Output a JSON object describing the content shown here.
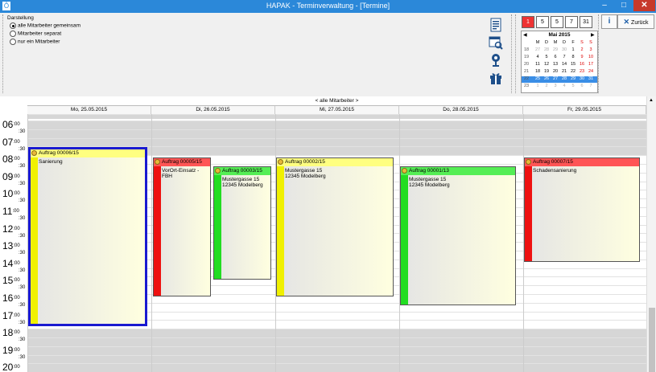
{
  "window": {
    "title": "HAPAK - Terminverwaltung - [Termine]",
    "minimize": "–",
    "maximize": "□",
    "close": "✕"
  },
  "display": {
    "group_label": "Darstellung",
    "options": [
      "alle Mitarbeiter gemeinsam",
      "Mitarbeiter separat",
      "nur ein Mitarbeiter"
    ],
    "selected": 0
  },
  "toolbar_icons": [
    "document-icon",
    "calendar-search-icon",
    "print-person-icon",
    "gift-icon"
  ],
  "view_buttons": [
    {
      "label": "1",
      "icon": "day-view-icon"
    },
    {
      "label": "5",
      "icon": "workweek-view-icon"
    },
    {
      "label": "5",
      "icon": "week-view-icon"
    },
    {
      "label": "7",
      "icon": "full-week-view-icon"
    },
    {
      "label": "31",
      "icon": "month-view-icon"
    }
  ],
  "calendar": {
    "month": "Mai 2015",
    "prev": "◀",
    "next": "▶",
    "weekdays": [
      "M",
      "D",
      "M",
      "D",
      "F",
      "S",
      "S"
    ],
    "weeks": [
      {
        "kw": "18",
        "days": [
          "27",
          "28",
          "29",
          "30",
          "1",
          "2",
          "3"
        ]
      },
      {
        "kw": "19",
        "days": [
          "4",
          "5",
          "6",
          "7",
          "8",
          "9",
          "10"
        ]
      },
      {
        "kw": "20",
        "days": [
          "11",
          "12",
          "13",
          "14",
          "15",
          "16",
          "17"
        ]
      },
      {
        "kw": "21",
        "days": [
          "18",
          "19",
          "20",
          "21",
          "22",
          "23",
          "24"
        ]
      },
      {
        "kw": "22",
        "days": [
          "25",
          "26",
          "27",
          "28",
          "29",
          "30",
          "31"
        ]
      },
      {
        "kw": "23",
        "days": [
          "1",
          "2",
          "3",
          "4",
          "5",
          "6",
          "7"
        ]
      }
    ]
  },
  "buttons": {
    "info": "i",
    "back": "Zurück",
    "back_icon": "✕"
  },
  "schedule": {
    "employee_header": "< alle Mitarbeiter >",
    "days": [
      "Mo, 25.05.2015",
      "Di, 26.05.2015",
      "Mi, 27.05.2015",
      "Do, 28.05.2015",
      "Fr, 29.05.2015"
    ],
    "hours": [
      "06",
      "07",
      "08",
      "09",
      "10",
      "11",
      "12",
      "13",
      "14",
      "15",
      "16",
      "17",
      "18",
      "19",
      "20"
    ],
    "minutes_full": ":00",
    "minutes_half": ":30",
    "appointments": [
      {
        "title": "Auftrag 00006/15",
        "lines": [
          "Sanierung"
        ],
        "bar_color": "#f0f000",
        "head_color": "#ffff80",
        "selected": true
      },
      {
        "title": "Auftrag 00005/15",
        "lines": [
          "VorOrt-Einsatz -",
          "FBH"
        ],
        "bar_color": "#ee1111",
        "head_color": "#ff5555",
        "selected": false
      },
      {
        "title": "Auftrag 00003/15",
        "lines": [
          "Mustergasse 15",
          "12345 Modelberg"
        ],
        "bar_color": "#22dd22",
        "head_color": "#55ee55",
        "selected": false
      },
      {
        "title": "Auftrag 00002/15",
        "lines": [
          "Mustergasse 15",
          "12345 Modelberg"
        ],
        "bar_color": "#f0f000",
        "head_color": "#ffff80",
        "selected": false
      },
      {
        "title": "Auftrag 00001/13",
        "lines": [
          "Mustergasse 15",
          "12345 Modelberg"
        ],
        "bar_color": "#22dd22",
        "head_color": "#55ee55",
        "selected": false
      },
      {
        "title": "Auftrag 00007/15",
        "lines": [
          "Schadensanierung"
        ],
        "bar_color": "#ee1111",
        "head_color": "#ff5555",
        "selected": false
      }
    ]
  }
}
